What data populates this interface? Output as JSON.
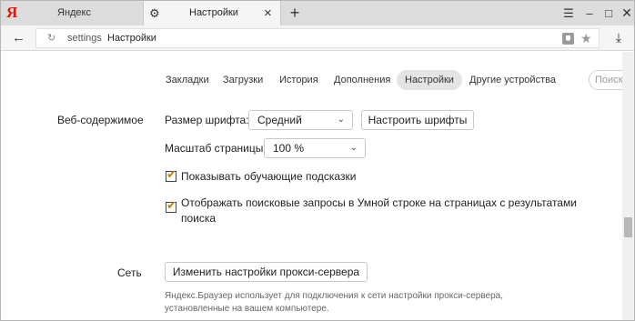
{
  "tabs": {
    "inactive_title": "Яндекс",
    "active_title": "Настройки"
  },
  "address": {
    "host": "settings",
    "title": "Настройки"
  },
  "nav": [
    "Закладки",
    "Загрузки",
    "История",
    "Дополнения",
    "Настройки",
    "Другие устройства"
  ],
  "search_placeholder": "Поиск",
  "web_content": {
    "section_label": "Веб-содержимое",
    "font_size_label": "Размер шрифта:",
    "font_size_value": "Средний",
    "customize_fonts_button": "Настроить шрифты",
    "page_zoom_label": "Масштаб страницы:",
    "page_zoom_value": "100 %",
    "show_hints_label": "Показывать обучающие подсказки",
    "show_hints_checked": true,
    "show_search_queries_line1": "Отображать поисковые запросы в Умной строке на страницах с результатами",
    "show_search_queries_line2": "поиска",
    "show_search_queries_checked": true
  },
  "network": {
    "section_label": "Сеть",
    "proxy_button": "Изменить настройки прокси-сервера",
    "hint_line1": "Яндекс.Браузер использует для подключения к сети настройки прокси-сервера,",
    "hint_line2": "установленные на вашем компьютере."
  }
}
